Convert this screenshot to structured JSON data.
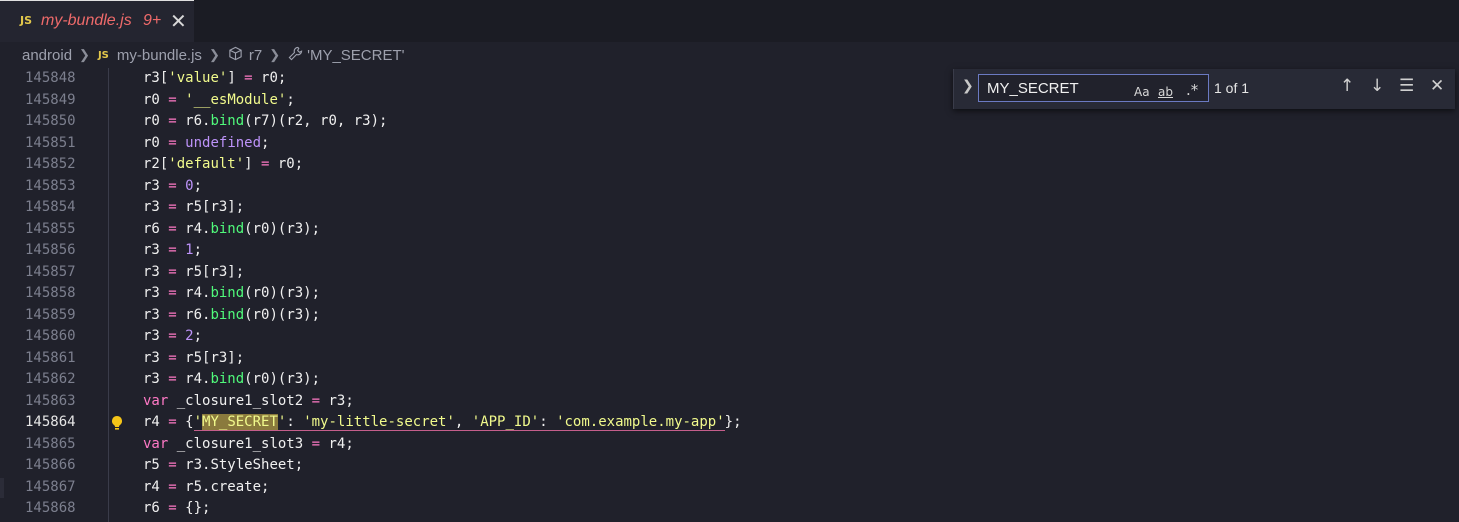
{
  "tab": {
    "icon": "JS",
    "name": "my-bundle.js",
    "badge": "9+",
    "close": "✕"
  },
  "breadcrumb": {
    "root": "android",
    "file_icon": "JS",
    "file": "my-bundle.js",
    "symbol": "r7",
    "property": "'MY_SECRET'"
  },
  "find": {
    "value": "MY_SECRET",
    "match_case": "Aa",
    "whole_word": "ab",
    "regex": ".*",
    "count": "1 of 1"
  },
  "lines": [
    {
      "no": "145848",
      "html": "r3[<span class='s'>'value'</span>] <span class='o'>=</span> r0;"
    },
    {
      "no": "145849",
      "html": "r0 <span class='o'>=</span> <span class='s'>'__esModule'</span>;"
    },
    {
      "no": "145850",
      "html": "r0 <span class='o'>=</span> r6.<span class='f'>bind</span>(r7)(r2, r0, r3);"
    },
    {
      "no": "145851",
      "html": "r0 <span class='o'>=</span> <span class='k'>undefined</span>;"
    },
    {
      "no": "145852",
      "html": "r2[<span class='s'>'default'</span>] <span class='o'>=</span> r0;"
    },
    {
      "no": "145853",
      "html": "r3 <span class='o'>=</span> <span class='n'>0</span>;"
    },
    {
      "no": "145854",
      "html": "r3 <span class='o'>=</span> r5[r3];"
    },
    {
      "no": "145855",
      "html": "r6 <span class='o'>=</span> r4.<span class='f'>bind</span>(r0)(r3);"
    },
    {
      "no": "145856",
      "html": "r3 <span class='o'>=</span> <span class='n'>1</span>;"
    },
    {
      "no": "145857",
      "html": "r3 <span class='o'>=</span> r5[r3];"
    },
    {
      "no": "145858",
      "html": "r3 <span class='o'>=</span> r4.<span class='f'>bind</span>(r0)(r3);"
    },
    {
      "no": "145859",
      "html": "r3 <span class='o'>=</span> r6.<span class='f'>bind</span>(r0)(r3);"
    },
    {
      "no": "145860",
      "html": "r3 <span class='o'>=</span> <span class='n'>2</span>;"
    },
    {
      "no": "145861",
      "html": "r3 <span class='o'>=</span> r5[r3];"
    },
    {
      "no": "145862",
      "html": "r3 <span class='o'>=</span> r4.<span class='f'>bind</span>(r0)(r3);"
    },
    {
      "no": "145863",
      "html": "<span class='kw'>var</span> _closure1_slot2 <span class='o'>=</span> r3;"
    },
    {
      "no": "145864",
      "html": "r4 <span class='o'>=</span> {<span class='underline'><span class='s'>'<span class='match'>MY_SECRET</span>'</span>: <span class='s'>'my-little-secret'</span>, <span class='s'>'APP_ID'</span>: <span class='s'>'com.example.my-app'</span></span>};",
      "current": true
    },
    {
      "no": "145865",
      "html": "<span class='kw'>var</span> _closure1_slot3 <span class='o'>=</span> r4;"
    },
    {
      "no": "145866",
      "html": "r5 <span class='o'>=</span> r3.StyleSheet;"
    },
    {
      "no": "145867",
      "html": "r4 <span class='o'>=</span> r5.create;"
    },
    {
      "no": "145868",
      "html": "r6 <span class='o'>=</span> {};"
    }
  ]
}
